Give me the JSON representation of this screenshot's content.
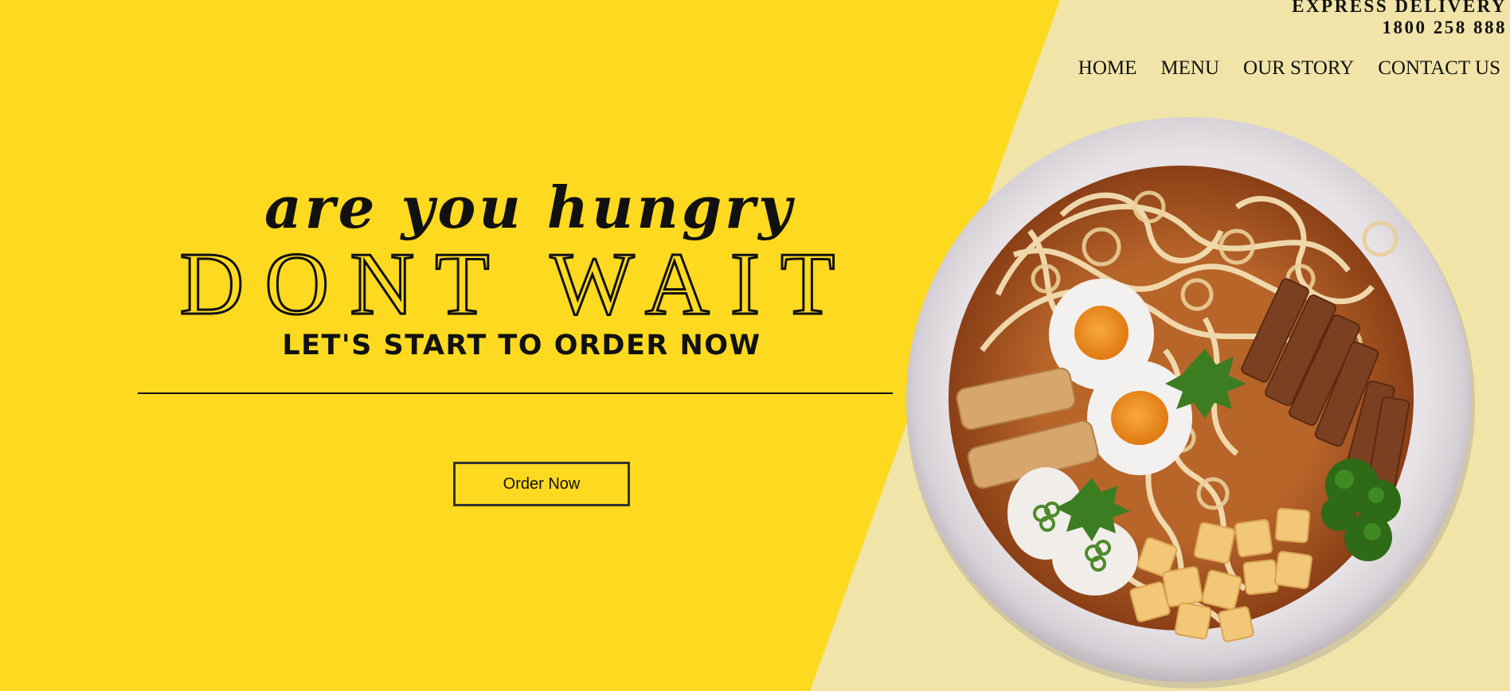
{
  "header": {
    "delivery_label": "EXPRESS DELIVERY",
    "phone": "1800 258 888"
  },
  "nav": {
    "items": [
      "HOME",
      "MENU",
      "OUR STORY",
      "CONTACT US"
    ]
  },
  "hero": {
    "tagline": "are you hungry",
    "headline": "DONT WAIT",
    "subheadline": "LET'S START TO ORDER NOW",
    "cta_label": "Order Now"
  },
  "image": {
    "description_icon": "ramen-bowl-image"
  },
  "colors": {
    "primary_yellow": "#fdd920",
    "secondary_cream": "#f0e4a8",
    "text": "#111111"
  }
}
